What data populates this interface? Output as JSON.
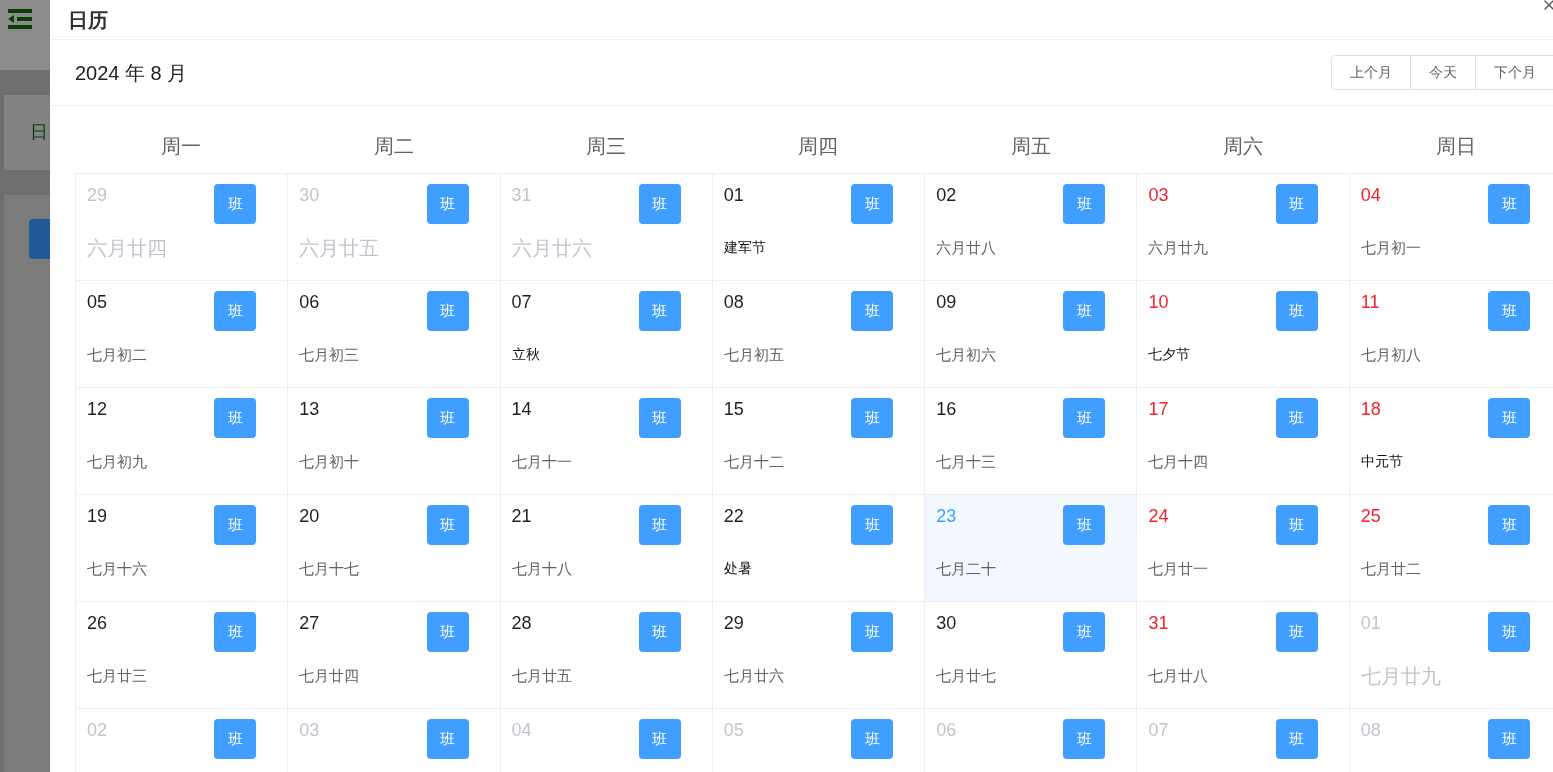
{
  "background": {
    "card_text": "日"
  },
  "dialog": {
    "title": "日历",
    "month": "2024 年 8 月",
    "nav_buttons": [
      "上个月",
      "今天",
      "下个月"
    ],
    "weekdays": [
      "周一",
      "周二",
      "周三",
      "周四",
      "周五",
      "周六",
      "周日"
    ],
    "weeks": [
      [
        {
          "day": "29",
          "note": "六月廿四",
          "kind": "lunar",
          "outside": true,
          "today": false,
          "button": "班"
        },
        {
          "day": "30",
          "note": "六月廿五",
          "kind": "lunar",
          "outside": true,
          "today": false,
          "button": "班"
        },
        {
          "day": "31",
          "note": "六月廿六",
          "kind": "lunar",
          "outside": true,
          "today": false,
          "button": "班"
        },
        {
          "day": "01",
          "note": "建军节",
          "kind": "festival",
          "outside": false,
          "weekend": false,
          "today": false,
          "button": "班"
        },
        {
          "day": "02",
          "note": "六月廿八",
          "kind": "lunar",
          "outside": false,
          "weekend": false,
          "today": false,
          "button": "班"
        },
        {
          "day": "03",
          "note": "六月廿九",
          "kind": "lunar",
          "outside": false,
          "weekend": true,
          "today": false,
          "button": "班"
        },
        {
          "day": "04",
          "note": "七月初一",
          "kind": "lunar",
          "outside": false,
          "weekend": true,
          "today": false,
          "button": "班"
        }
      ],
      [
        {
          "day": "05",
          "note": "七月初二",
          "kind": "lunar",
          "outside": false,
          "weekend": false,
          "today": false,
          "button": "班"
        },
        {
          "day": "06",
          "note": "七月初三",
          "kind": "lunar",
          "outside": false,
          "weekend": false,
          "today": false,
          "button": "班"
        },
        {
          "day": "07",
          "note": "立秋",
          "kind": "festival",
          "outside": false,
          "weekend": false,
          "today": false,
          "button": "班"
        },
        {
          "day": "08",
          "note": "七月初五",
          "kind": "lunar",
          "outside": false,
          "weekend": false,
          "today": false,
          "button": "班"
        },
        {
          "day": "09",
          "note": "七月初六",
          "kind": "lunar",
          "outside": false,
          "weekend": false,
          "today": false,
          "button": "班"
        },
        {
          "day": "10",
          "note": "七夕节",
          "kind": "festival",
          "outside": false,
          "weekend": true,
          "today": false,
          "button": "班"
        },
        {
          "day": "11",
          "note": "七月初八",
          "kind": "lunar",
          "outside": false,
          "weekend": true,
          "today": false,
          "button": "班"
        }
      ],
      [
        {
          "day": "12",
          "note": "七月初九",
          "kind": "lunar",
          "outside": false,
          "weekend": false,
          "today": false,
          "button": "班"
        },
        {
          "day": "13",
          "note": "七月初十",
          "kind": "lunar",
          "outside": false,
          "weekend": false,
          "today": false,
          "button": "班"
        },
        {
          "day": "14",
          "note": "七月十一",
          "kind": "lunar",
          "outside": false,
          "weekend": false,
          "today": false,
          "button": "班"
        },
        {
          "day": "15",
          "note": "七月十二",
          "kind": "lunar",
          "outside": false,
          "weekend": false,
          "today": false,
          "button": "班"
        },
        {
          "day": "16",
          "note": "七月十三",
          "kind": "lunar",
          "outside": false,
          "weekend": false,
          "today": false,
          "button": "班"
        },
        {
          "day": "17",
          "note": "七月十四",
          "kind": "lunar",
          "outside": false,
          "weekend": true,
          "today": false,
          "button": "班"
        },
        {
          "day": "18",
          "note": "中元节",
          "kind": "festival",
          "outside": false,
          "weekend": true,
          "today": false,
          "button": "班"
        }
      ],
      [
        {
          "day": "19",
          "note": "七月十六",
          "kind": "lunar",
          "outside": false,
          "weekend": false,
          "today": false,
          "button": "班"
        },
        {
          "day": "20",
          "note": "七月十七",
          "kind": "lunar",
          "outside": false,
          "weekend": false,
          "today": false,
          "button": "班"
        },
        {
          "day": "21",
          "note": "七月十八",
          "kind": "lunar",
          "outside": false,
          "weekend": false,
          "today": false,
          "button": "班"
        },
        {
          "day": "22",
          "note": "处暑",
          "kind": "festival",
          "outside": false,
          "weekend": false,
          "today": false,
          "button": "班"
        },
        {
          "day": "23",
          "note": "七月二十",
          "kind": "lunar",
          "outside": false,
          "today": true,
          "button": "班"
        },
        {
          "day": "24",
          "note": "七月廿一",
          "kind": "lunar",
          "outside": false,
          "weekend": true,
          "today": false,
          "button": "班"
        },
        {
          "day": "25",
          "note": "七月廿二",
          "kind": "lunar",
          "outside": false,
          "weekend": true,
          "today": false,
          "button": "班"
        }
      ],
      [
        {
          "day": "26",
          "note": "七月廿三",
          "kind": "lunar",
          "outside": false,
          "weekend": false,
          "today": false,
          "button": "班"
        },
        {
          "day": "27",
          "note": "七月廿四",
          "kind": "lunar",
          "outside": false,
          "weekend": false,
          "today": false,
          "button": "班"
        },
        {
          "day": "28",
          "note": "七月廿五",
          "kind": "lunar",
          "outside": false,
          "weekend": false,
          "today": false,
          "button": "班"
        },
        {
          "day": "29",
          "note": "七月廿六",
          "kind": "lunar",
          "outside": false,
          "weekend": false,
          "today": false,
          "button": "班"
        },
        {
          "day": "30",
          "note": "七月廿七",
          "kind": "lunar",
          "outside": false,
          "weekend": false,
          "today": false,
          "button": "班"
        },
        {
          "day": "31",
          "note": "七月廿八",
          "kind": "lunar",
          "outside": false,
          "weekend": true,
          "today": false,
          "button": "班"
        },
        {
          "day": "01",
          "note": "七月廿九",
          "kind": "lunar",
          "outside": true,
          "today": false,
          "button": "班"
        }
      ],
      [
        {
          "day": "02",
          "outside": true,
          "today": false,
          "button": "班"
        },
        {
          "day": "03",
          "outside": true,
          "today": false,
          "button": "班"
        },
        {
          "day": "04",
          "outside": true,
          "today": false,
          "button": "班"
        },
        {
          "day": "05",
          "outside": true,
          "today": false,
          "button": "班"
        },
        {
          "day": "06",
          "outside": true,
          "today": false,
          "button": "班"
        },
        {
          "day": "07",
          "outside": true,
          "today": false,
          "button": "班"
        },
        {
          "day": "08",
          "outside": true,
          "today": false,
          "button": "班"
        }
      ]
    ]
  }
}
